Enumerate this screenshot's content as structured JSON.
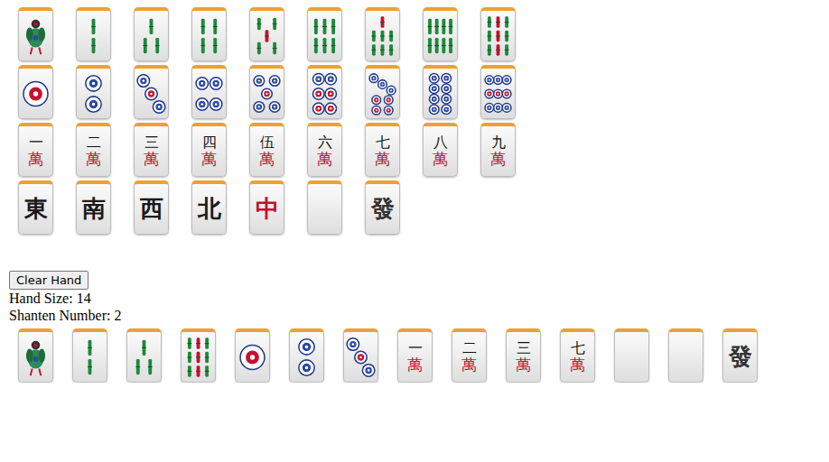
{
  "palette": {
    "rows": [
      [
        {
          "kind": "sou1"
        },
        {
          "kind": "sou2"
        },
        {
          "kind": "sou3"
        },
        {
          "kind": "sou4"
        },
        {
          "kind": "sou5"
        },
        {
          "kind": "sou6"
        },
        {
          "kind": "sou7"
        },
        {
          "kind": "sou8"
        },
        {
          "kind": "sou9"
        }
      ],
      [
        {
          "kind": "pin1"
        },
        {
          "kind": "pin2"
        },
        {
          "kind": "pin3"
        },
        {
          "kind": "pin4"
        },
        {
          "kind": "pin5"
        },
        {
          "kind": "pin6"
        },
        {
          "kind": "pin7"
        },
        {
          "kind": "pin8"
        },
        {
          "kind": "pin9"
        }
      ],
      [
        {
          "kind": "man",
          "numeral": "一",
          "suit_char": "萬"
        },
        {
          "kind": "man",
          "numeral": "二",
          "suit_char": "萬"
        },
        {
          "kind": "man",
          "numeral": "三",
          "suit_char": "萬"
        },
        {
          "kind": "man",
          "numeral": "四",
          "suit_char": "萬"
        },
        {
          "kind": "man",
          "numeral": "伍",
          "suit_char": "萬"
        },
        {
          "kind": "man",
          "numeral": "六",
          "suit_char": "萬"
        },
        {
          "kind": "man",
          "numeral": "七",
          "suit_char": "萬"
        },
        {
          "kind": "man",
          "numeral": "八",
          "suit_char": "萬"
        },
        {
          "kind": "man",
          "numeral": "九",
          "suit_char": "萬"
        }
      ],
      [
        {
          "kind": "honor",
          "text": "東",
          "color": "#1a1a1a"
        },
        {
          "kind": "honor",
          "text": "南",
          "color": "#1a1a1a"
        },
        {
          "kind": "honor",
          "text": "西",
          "color": "#1a1a1a"
        },
        {
          "kind": "honor",
          "text": "北",
          "color": "#1a1a1a"
        },
        {
          "kind": "honor",
          "text": "中",
          "color": "#c8102e"
        },
        {
          "kind": "haku"
        },
        {
          "kind": "honor",
          "text": "發",
          "color": "#333333"
        }
      ]
    ]
  },
  "controls": {
    "clear_button": "Clear Hand"
  },
  "status": {
    "hand_size": "Hand Size: 14",
    "shanten": "Shanten Number: 2"
  },
  "hand": [
    {
      "kind": "sou1"
    },
    {
      "kind": "sou2"
    },
    {
      "kind": "sou3"
    },
    {
      "kind": "sou9"
    },
    {
      "kind": "pin1"
    },
    {
      "kind": "pin2"
    },
    {
      "kind": "pin3"
    },
    {
      "kind": "man",
      "numeral": "一",
      "suit_char": "萬"
    },
    {
      "kind": "man",
      "numeral": "二",
      "suit_char": "萬"
    },
    {
      "kind": "man",
      "numeral": "三",
      "suit_char": "萬"
    },
    {
      "kind": "man",
      "numeral": "七",
      "suit_char": "萬"
    },
    {
      "kind": "haku"
    },
    {
      "kind": "haku"
    },
    {
      "kind": "honor",
      "text": "發",
      "color": "#333333"
    }
  ]
}
